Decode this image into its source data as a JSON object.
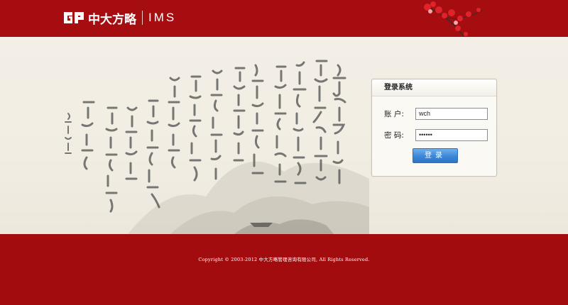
{
  "header": {
    "brand_name": "中大方略",
    "product": "IMS",
    "logo_icon": "gp-logo-icon",
    "decoration_icon": "plum-blossom-icon"
  },
  "login": {
    "title": "登录系统",
    "username_label": "账 户:",
    "username_value": "wch",
    "password_label": "密 码:",
    "password_value": "••••••",
    "submit_label": "登录"
  },
  "footer": {
    "copyright": "Copyright © 2003-2012 中大方略管理咨询有限公司, All Rights Reserved."
  },
  "colors": {
    "brand_red": "#a50d10",
    "button_blue": "#3b86d6",
    "banner_bg": "#f1ede3"
  }
}
